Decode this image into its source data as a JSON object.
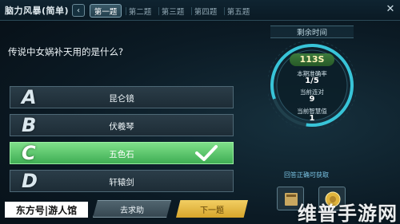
{
  "header": {
    "title": "脑力风暴(简单)",
    "back_icon": "chevron-left-icon",
    "tabs": [
      {
        "label": "第一题",
        "active": true
      },
      {
        "label": "第二题",
        "active": false
      },
      {
        "label": "第三题",
        "active": false
      },
      {
        "label": "第四题",
        "active": false
      },
      {
        "label": "第五题",
        "active": false
      }
    ],
    "close_icon": "close-icon"
  },
  "question": {
    "text": "传说中女娲补天用的是什么?"
  },
  "answers": [
    {
      "letter": "A",
      "text": "昆仑镜",
      "correct": false
    },
    {
      "letter": "B",
      "text": "伏羲琴",
      "correct": false
    },
    {
      "letter": "C",
      "text": "五色石",
      "correct": true
    },
    {
      "letter": "D",
      "text": "轩辕剑",
      "correct": false
    }
  ],
  "panel": {
    "remaining_title": "剩余时间",
    "timer": "113S",
    "stats": [
      {
        "label": "本期准确率",
        "value": "1/5"
      },
      {
        "label": "当前连对",
        "value": "9"
      },
      {
        "label": "当前智慧值",
        "value": "1"
      }
    ],
    "reward_label": "回答正确可获取"
  },
  "footer": {
    "brand": "东方号|游人馆",
    "help_button": "去求助",
    "next_button": "下一题",
    "watermark": "维普手游网"
  },
  "colors": {
    "correct_green": "#4fbf5f",
    "timer_green": "#3c7a3c",
    "next_gold": "#e6b840",
    "ring_cyan": "#38c4d8"
  }
}
